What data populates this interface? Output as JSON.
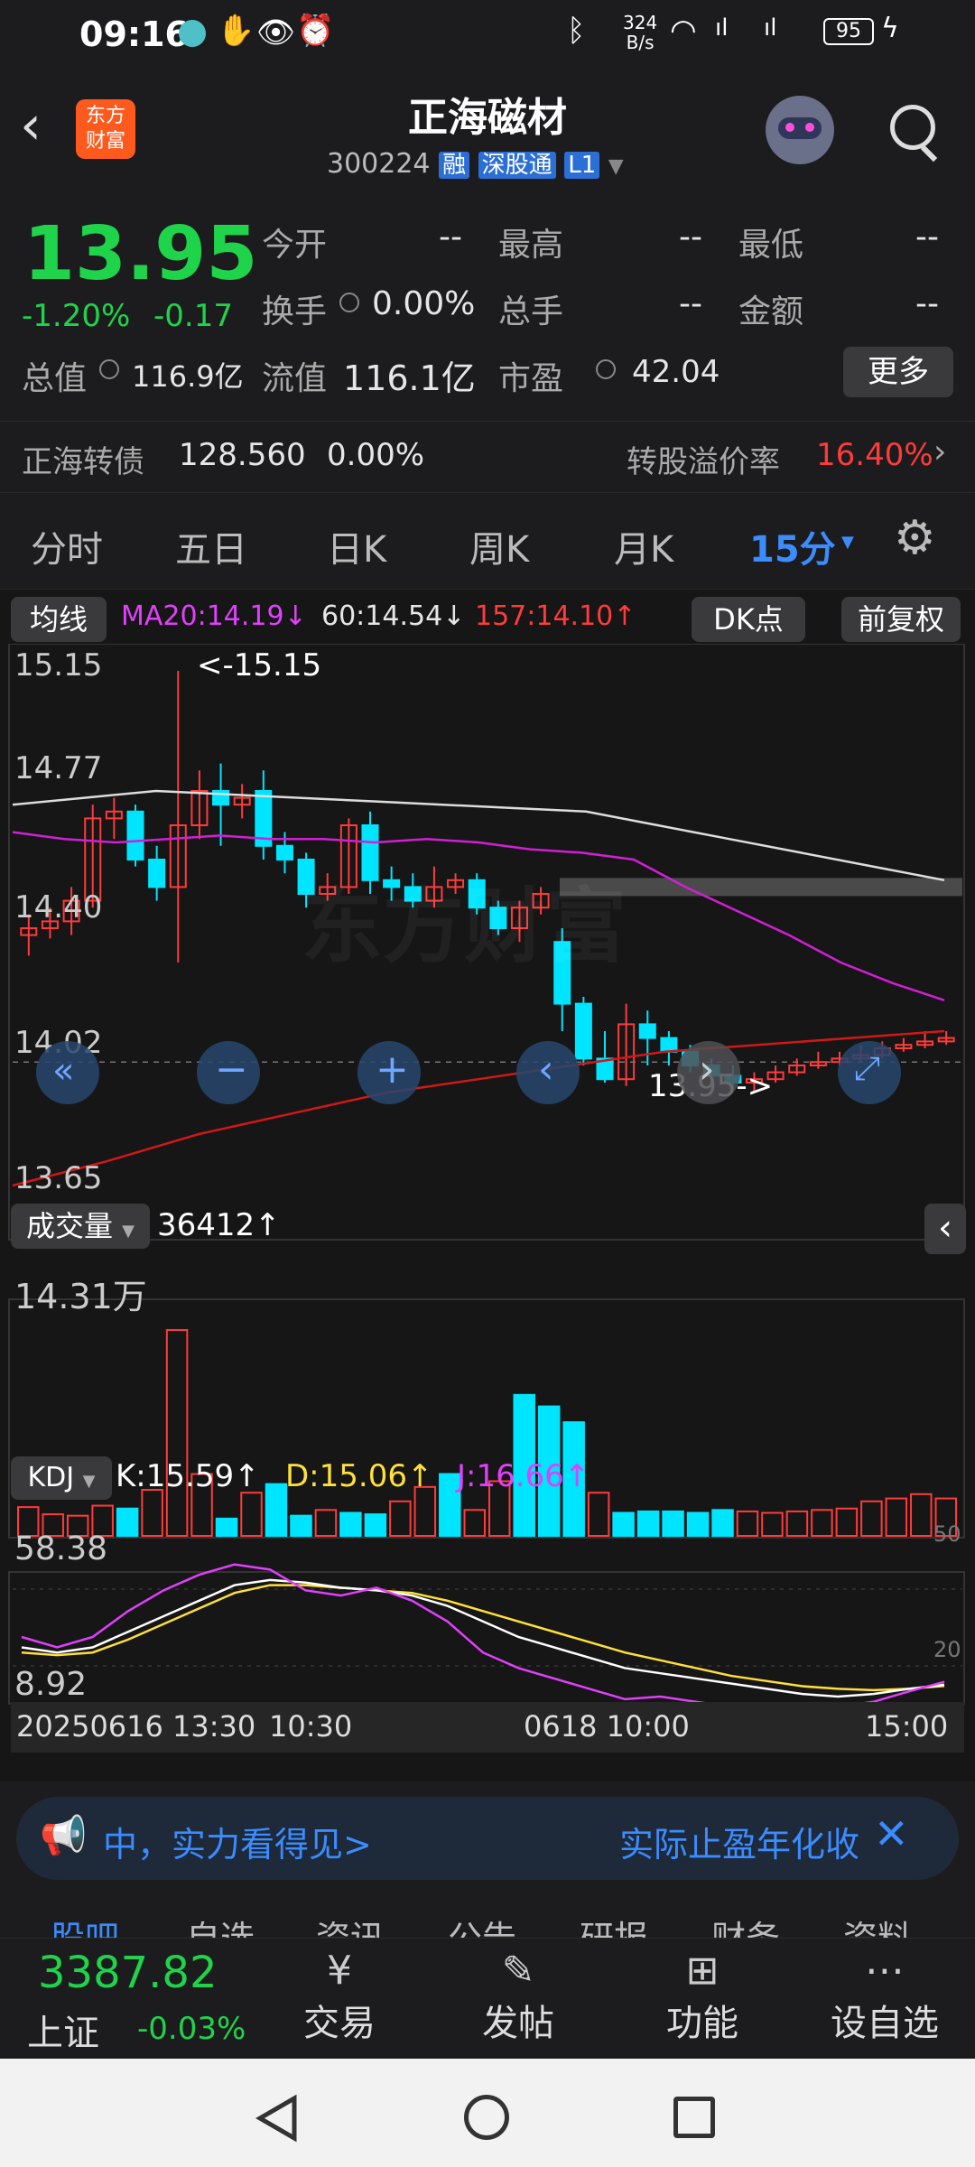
{
  "status_bar": {
    "time": "09:16",
    "net_speed_top": "324",
    "net_speed_bottom": "B/s",
    "battery": "95"
  },
  "header": {
    "logo_line1": "东方",
    "logo_line2": "财富",
    "title": "正海磁材",
    "code": "300224",
    "badge_rong": "融",
    "badge_sgt": "深股通",
    "badge_l1": "L1"
  },
  "quote": {
    "price": "13.95",
    "change_pct": "-1.20%",
    "change": "-0.17",
    "fields": [
      {
        "label": "今开",
        "value": "--"
      },
      {
        "label": "最高",
        "value": "--"
      },
      {
        "label": "最低",
        "value": "--"
      },
      {
        "label": "换手",
        "value": "0.00%"
      },
      {
        "label": "总手",
        "value": "--"
      },
      {
        "label": "金额",
        "value": "--"
      },
      {
        "label": "总值",
        "value": "116.9亿"
      },
      {
        "label": "流值",
        "value": "116.1亿"
      },
      {
        "label": "市盈",
        "value": "42.04"
      }
    ],
    "more_button": "更多",
    "bond_name": "正海转债",
    "bond_price": "128.560",
    "bond_pct": "0.00%",
    "premium_label": "转股溢价率",
    "premium_value": "16.40%"
  },
  "tabs": [
    "分时",
    "五日",
    "日K",
    "周K",
    "月K",
    "15分"
  ],
  "chart": {
    "ma_button": "均线",
    "ma20": "MA20:14.19↓",
    "ma60": "60:14.54↓",
    "ma157": "157:14.10↑",
    "dk_button": "DK点",
    "fq_button": "前复权",
    "y_labels": [
      "15.15",
      "14.77",
      "14.40",
      "14.02",
      "13.65"
    ],
    "high_marker": "<-15.15",
    "low_marker": "13.95->",
    "watermark": "东方财富",
    "vol_button": "成交量",
    "vol_value": "36412↑",
    "vol_max": "14.31万",
    "kdj_button": "KDJ",
    "kdj_k": "K:15.59↑",
    "kdj_d": "D:15.06↑",
    "kdj_j": "J:16.66↑",
    "kdj_top": "58.38",
    "kdj_bottom": "8.92",
    "kdj_50": "50",
    "kdj_20": "20",
    "x_labels": [
      "20250616 13:30",
      "10:30",
      "0618 10:00",
      "15:00"
    ]
  },
  "chart_data": {
    "type": "candlestick",
    "ylim": [
      13.65,
      15.15
    ],
    "candles": [
      [
        14.38,
        14.4,
        14.32,
        14.44
      ],
      [
        14.4,
        14.42,
        14.37,
        14.46
      ],
      [
        14.42,
        14.48,
        14.38,
        14.52
      ],
      [
        14.48,
        14.72,
        14.46,
        14.76
      ],
      [
        14.72,
        14.74,
        14.66,
        14.78
      ],
      [
        14.74,
        14.6,
        14.58,
        14.76
      ],
      [
        14.6,
        14.52,
        14.48,
        14.64
      ],
      [
        14.52,
        14.7,
        14.3,
        15.15
      ],
      [
        14.7,
        14.8,
        14.66,
        14.86
      ],
      [
        14.8,
        14.76,
        14.64,
        14.88
      ],
      [
        14.76,
        14.78,
        14.72,
        14.82
      ],
      [
        14.8,
        14.64,
        14.6,
        14.86
      ],
      [
        14.64,
        14.6,
        14.56,
        14.68
      ],
      [
        14.6,
        14.5,
        14.46,
        14.62
      ],
      [
        14.5,
        14.52,
        14.48,
        14.56
      ],
      [
        14.52,
        14.7,
        14.5,
        14.72
      ],
      [
        14.7,
        14.54,
        14.5,
        14.74
      ],
      [
        14.54,
        14.52,
        14.48,
        14.58
      ],
      [
        14.52,
        14.48,
        14.46,
        14.56
      ],
      [
        14.48,
        14.52,
        14.46,
        14.58
      ],
      [
        14.52,
        14.54,
        14.5,
        14.56
      ],
      [
        14.54,
        14.46,
        14.44,
        14.56
      ],
      [
        14.46,
        14.4,
        14.38,
        14.48
      ],
      [
        14.4,
        14.46,
        14.36,
        14.48
      ],
      [
        14.46,
        14.5,
        14.44,
        14.52
      ],
      [
        14.36,
        14.18,
        14.1,
        14.4
      ],
      [
        14.18,
        14.02,
        14.0,
        14.2
      ],
      [
        14.02,
        13.96,
        13.95,
        14.1
      ],
      [
        13.96,
        14.12,
        13.94,
        14.18
      ],
      [
        14.12,
        14.08,
        14.0,
        14.16
      ],
      [
        14.08,
        14.04,
        14.0,
        14.1
      ],
      [
        14.04,
        14.0,
        13.98,
        14.06
      ],
      [
        14.0,
        13.97,
        13.95,
        14.02
      ],
      [
        13.97,
        13.95,
        13.93,
        14.0
      ],
      [
        13.95,
        13.96,
        13.92,
        13.98
      ],
      [
        13.96,
        13.98,
        13.95,
        14.0
      ],
      [
        13.98,
        14.0,
        13.97,
        14.02
      ],
      [
        14.0,
        14.01,
        13.99,
        14.04
      ],
      [
        14.01,
        14.02,
        14.0,
        14.04
      ],
      [
        14.02,
        14.03,
        14.01,
        14.06
      ],
      [
        14.03,
        14.05,
        14.02,
        14.07
      ],
      [
        14.05,
        14.06,
        14.04,
        14.08
      ],
      [
        14.06,
        14.07,
        14.05,
        14.1
      ],
      [
        14.07,
        14.08,
        14.06,
        14.1
      ]
    ],
    "volumes": [
      2.0,
      1.5,
      1.4,
      2.1,
      1.9,
      3.2,
      14.31,
      4.3,
      1.2,
      3.0,
      3.6,
      1.4,
      1.8,
      1.6,
      1.5,
      2.4,
      3.4,
      4.3,
      1.8,
      3.8,
      9.8,
      9.0,
      7.9,
      3.0,
      1.6,
      1.7,
      1.7,
      1.6,
      1.8,
      1.7,
      1.6,
      1.7,
      1.8,
      1.9,
      2.4,
      2.6,
      2.9,
      2.6
    ],
    "ma20": [
      14.68,
      14.66,
      14.65,
      14.66,
      14.67,
      14.66,
      14.66,
      14.65,
      14.66,
      14.65,
      14.63,
      14.62,
      14.6,
      14.52,
      14.45,
      14.38,
      14.3,
      14.24,
      14.19
    ],
    "ma60": [
      14.76,
      14.78,
      14.8,
      14.79,
      14.78,
      14.77,
      14.76,
      14.75,
      14.74,
      14.7,
      14.66,
      14.62,
      14.58,
      14.54
    ],
    "ma157": [
      13.65,
      13.72,
      13.8,
      13.86,
      13.92,
      13.96,
      14.0,
      14.04,
      14.06,
      14.08,
      14.1
    ]
  },
  "notice": {
    "text": "中，实力看得见>",
    "right": "实际止盈年化收"
  },
  "sub_tabs": [
    "股吧",
    "自选",
    "资讯",
    "公告",
    "研报",
    "财务",
    "资料"
  ],
  "bottom_nav": {
    "index_value": "3387.82",
    "index_name": "上证",
    "index_change": "-0.03%",
    "items": [
      "交易",
      "发帖",
      "功能",
      "设自选"
    ]
  }
}
